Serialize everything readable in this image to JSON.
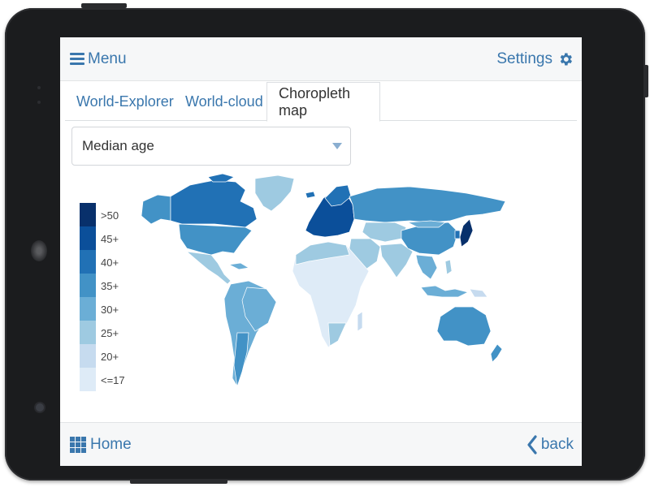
{
  "header": {
    "menu_label": "Menu",
    "settings_label": "Settings"
  },
  "tabs": [
    {
      "label": "World-Explorer",
      "active": false
    },
    {
      "label": "World-cloud",
      "active": false
    },
    {
      "label": "Choropleth map",
      "active": true
    }
  ],
  "metric_select": {
    "selected": "Median age"
  },
  "legend": {
    "bins": [
      {
        "label": ">50",
        "color": "#08306b"
      },
      {
        "label": "45+",
        "color": "#0b4f9a"
      },
      {
        "label": "40+",
        "color": "#2171b5"
      },
      {
        "label": "35+",
        "color": "#4292c6"
      },
      {
        "label": "30+",
        "color": "#6baed6"
      },
      {
        "label": "25+",
        "color": "#9ecae1"
      },
      {
        "label": "20+",
        "color": "#c6dbef"
      },
      {
        "label": "<=17",
        "color": "#deebf7"
      }
    ]
  },
  "footer": {
    "home_label": "Home",
    "back_label": "back"
  },
  "icons": {
    "menu": "hamburger-icon",
    "settings": "gear-icon",
    "select_caret": "caret-down-icon",
    "home": "grid-icon",
    "back": "chevron-left-icon"
  },
  "colors": {
    "accent": "#3a77ad",
    "map_highest": "#08306b",
    "map_high": "#2171b5",
    "map_mid": "#4292c6",
    "map_low": "#9ecae1",
    "map_lowest": "#deebf7"
  }
}
